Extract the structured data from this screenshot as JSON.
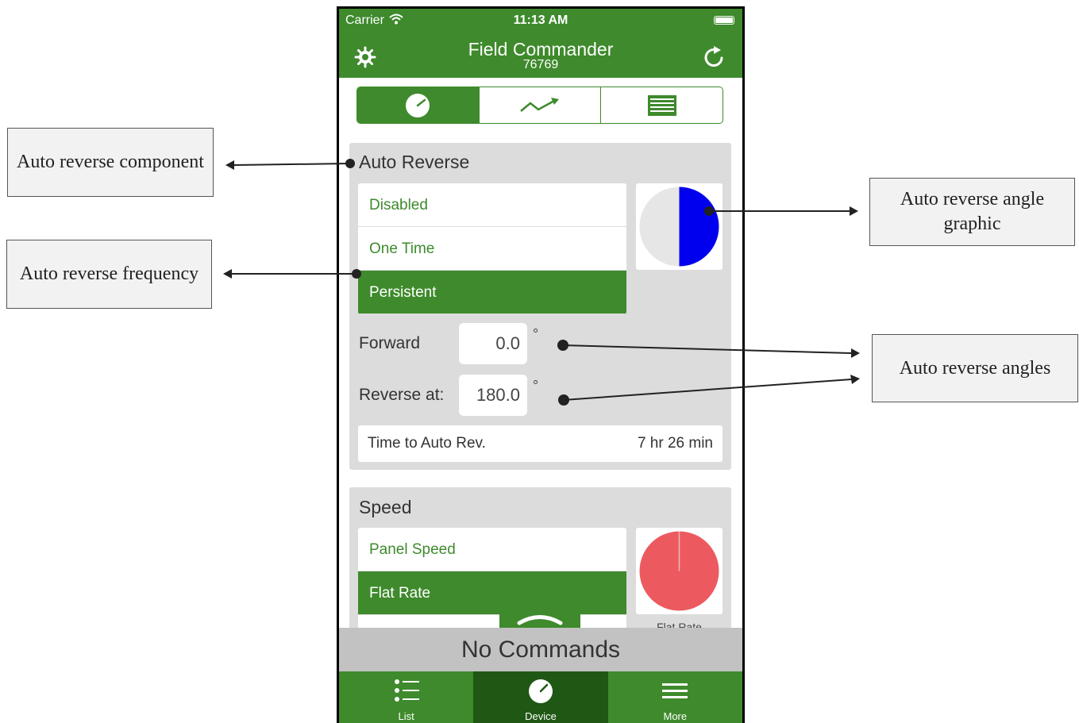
{
  "status_bar": {
    "carrier": "Carrier",
    "time": "11:13 AM"
  },
  "header": {
    "title": "Field Commander",
    "subtitle": "76769"
  },
  "segments": [
    {
      "icon": "gauge-icon",
      "active": true
    },
    {
      "icon": "trend-chart-icon",
      "active": false
    },
    {
      "icon": "table-icon",
      "active": false
    }
  ],
  "auto_reverse": {
    "title": "Auto Reverse",
    "options": [
      {
        "label": "Disabled",
        "selected": false
      },
      {
        "label": "One Time",
        "selected": false
      },
      {
        "label": "Persistent",
        "selected": true
      }
    ],
    "forward_label": "Forward",
    "forward_value": "0.0",
    "reverse_label": "Reverse at:",
    "reverse_value": "180.0",
    "degree_symbol": "°",
    "time_label": "Time to Auto Rev.",
    "time_value": "7 hr 26 min",
    "graphic_color": "#0000ee"
  },
  "speed": {
    "title": "Speed",
    "options": [
      {
        "label": "Panel Speed",
        "selected": false
      },
      {
        "label": "Flat Rate",
        "selected": true
      }
    ],
    "graphic_color": "#ec5a60",
    "graphic_caption": "Flat Rate"
  },
  "commands_bar": "No Commands",
  "tabs": [
    {
      "label": "List",
      "icon": "list-icon",
      "active": false
    },
    {
      "label": "Device",
      "icon": "gauge-icon",
      "active": true
    },
    {
      "label": "More",
      "icon": "menu-icon",
      "active": false
    }
  ],
  "callouts": {
    "component": "Auto reverse component",
    "frequency": "Auto reverse frequency",
    "angle_graphic": "Auto reverse angle graphic",
    "angles": "Auto reverse angles"
  },
  "colors": {
    "brand_green": "#3e8a2c",
    "dark_green": "#1f5714",
    "panel_gray": "#dcdcdc"
  }
}
